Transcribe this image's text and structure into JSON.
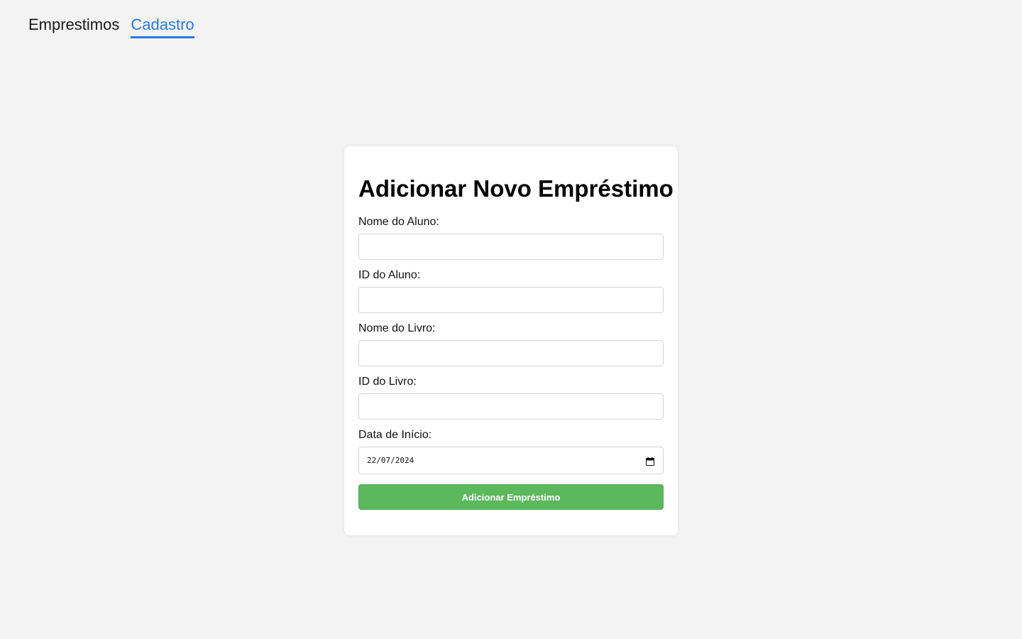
{
  "nav": {
    "links": [
      {
        "label": "Emprestimos",
        "active": false
      },
      {
        "label": "Cadastro",
        "active": true
      }
    ],
    "active_color": "#2b7ae0"
  },
  "form": {
    "title": "Adicionar Novo Empréstimo",
    "fields": [
      {
        "label": "Nome do Aluno:",
        "value": ""
      },
      {
        "label": "ID do Aluno:",
        "value": ""
      },
      {
        "label": "Nome do Livro:",
        "value": ""
      },
      {
        "label": "ID do Livro:",
        "value": ""
      }
    ],
    "date_field": {
      "label": "Data de Início:",
      "value": "22/07/2024",
      "icon": "calendar-icon"
    },
    "submit_label": "Adicionar Empréstimo",
    "submit_color": "#5cb85c"
  },
  "colors": {
    "page_background": "#f3f3f3",
    "card_background": "#ffffff"
  }
}
